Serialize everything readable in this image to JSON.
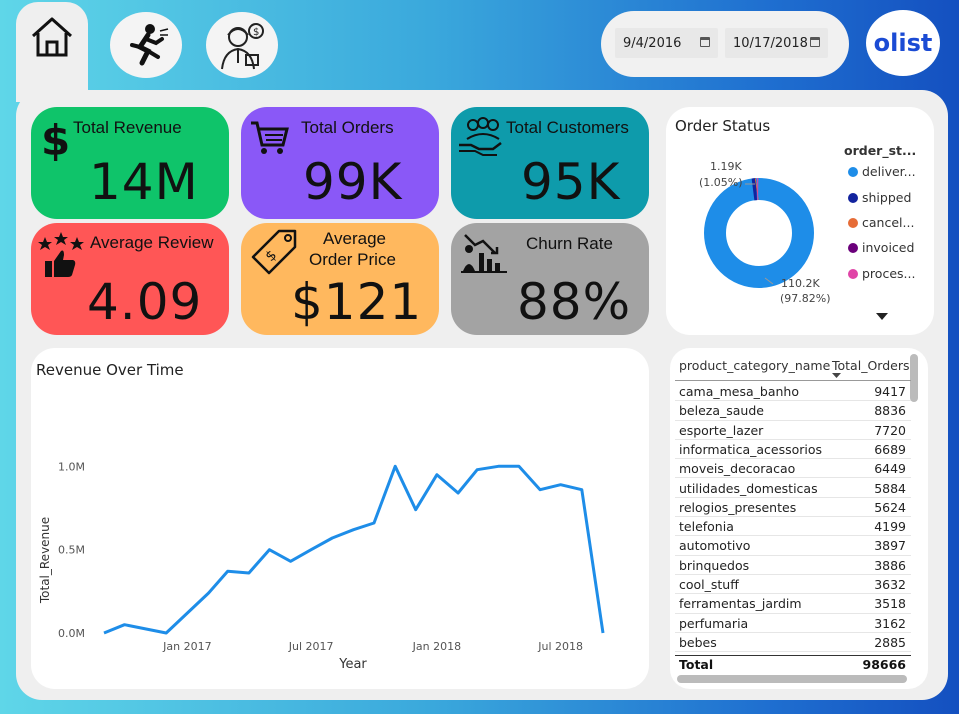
{
  "nav": {
    "home_icon": "home-icon",
    "churn_page_icon": "running-person-icon",
    "seller_page_icon": "seller-icon"
  },
  "date_filter": {
    "start": "9/4/2016",
    "end": "10/17/2018"
  },
  "brand": {
    "logo_text": "olist",
    "color": "#1b4bd4"
  },
  "kpis": [
    {
      "id": "total-revenue",
      "label": "Total Revenue",
      "value": "14M",
      "color": "#0fc46a",
      "icon": "dollar-icon"
    },
    {
      "id": "total-orders",
      "label": "Total Orders",
      "value": "99K",
      "color": "#8a58f7",
      "icon": "shopping-cart-icon"
    },
    {
      "id": "total-customers",
      "label": "Total Customers",
      "value": "95K",
      "color": "#0e9bab",
      "icon": "customers-hand-icon"
    },
    {
      "id": "average-review",
      "label": "Average Review",
      "value": "4.09",
      "color": "#ff5656",
      "icon": "stars-thumbs-up-icon"
    },
    {
      "id": "average-order-price",
      "label_line1": "Average",
      "label_line2": "Order Price",
      "value": "$121",
      "color": "#ffb85e",
      "icon": "price-tag-icon"
    },
    {
      "id": "churn-rate",
      "label": "Churn Rate",
      "value": "88%",
      "color": "#a3a3a3",
      "icon": "declining-chart-icon"
    }
  ],
  "order_status": {
    "title": "Order Status",
    "legend_title": "order_st...",
    "legend": [
      {
        "label": "deliver...",
        "color": "#1e8de8"
      },
      {
        "label": "shipped",
        "color": "#12239e"
      },
      {
        "label": "cancel...",
        "color": "#e66c37"
      },
      {
        "label": "invoiced",
        "color": "#6b007b"
      },
      {
        "label": "proces...",
        "color": "#e044a7"
      }
    ],
    "label_big_line1": "110.2K",
    "label_big_line2": "(97.82%)",
    "label_small_line1": "1.19K",
    "label_small_line2": "(1.05%)",
    "scroll_more_icon": "triangle-down-icon"
  },
  "chart_data": {
    "type": "line",
    "title": "Revenue Over Time",
    "xlabel": "Year",
    "ylabel": "Total_Revenue",
    "x_ticks": [
      "Jan 2017",
      "Jul 2017",
      "Jan 2018",
      "Jul 2018"
    ],
    "y_ticks": [
      "0.0M",
      "0.5M",
      "1.0M"
    ],
    "ylim": [
      0,
      1.2
    ],
    "color": "#1e8de8",
    "x": [
      "2016-09",
      "2016-10",
      "2016-12",
      "2017-01",
      "2017-02",
      "2017-03",
      "2017-04",
      "2017-05",
      "2017-06",
      "2017-07",
      "2017-08",
      "2017-09",
      "2017-10",
      "2017-11",
      "2017-12",
      "2018-01",
      "2018-02",
      "2018-03",
      "2018-04",
      "2018-05",
      "2018-06",
      "2018-07",
      "2018-08",
      "2018-09"
    ],
    "values": [
      0.0,
      0.05,
      0.0,
      0.12,
      0.24,
      0.37,
      0.36,
      0.5,
      0.43,
      0.5,
      0.57,
      0.62,
      0.66,
      1.0,
      0.74,
      0.95,
      0.84,
      0.98,
      1.0,
      1.0,
      0.86,
      0.89,
      0.86,
      0.0
    ]
  },
  "category_table": {
    "col_category": "product_category_name",
    "col_orders": "Total_Orders",
    "rows": [
      {
        "category": "cama_mesa_banho",
        "orders": "9417"
      },
      {
        "category": "beleza_saude",
        "orders": "8836"
      },
      {
        "category": "esporte_lazer",
        "orders": "7720"
      },
      {
        "category": "informatica_acessorios",
        "orders": "6689"
      },
      {
        "category": "moveis_decoracao",
        "orders": "6449"
      },
      {
        "category": "utilidades_domesticas",
        "orders": "5884"
      },
      {
        "category": "relogios_presentes",
        "orders": "5624"
      },
      {
        "category": "telefonia",
        "orders": "4199"
      },
      {
        "category": "automotivo",
        "orders": "3897"
      },
      {
        "category": "brinquedos",
        "orders": "3886"
      },
      {
        "category": "cool_stuff",
        "orders": "3632"
      },
      {
        "category": "ferramentas_jardim",
        "orders": "3518"
      },
      {
        "category": "perfumaria",
        "orders": "3162"
      },
      {
        "category": "bebes",
        "orders": "2885"
      }
    ],
    "total_label": "Total",
    "total_value": "98666"
  }
}
